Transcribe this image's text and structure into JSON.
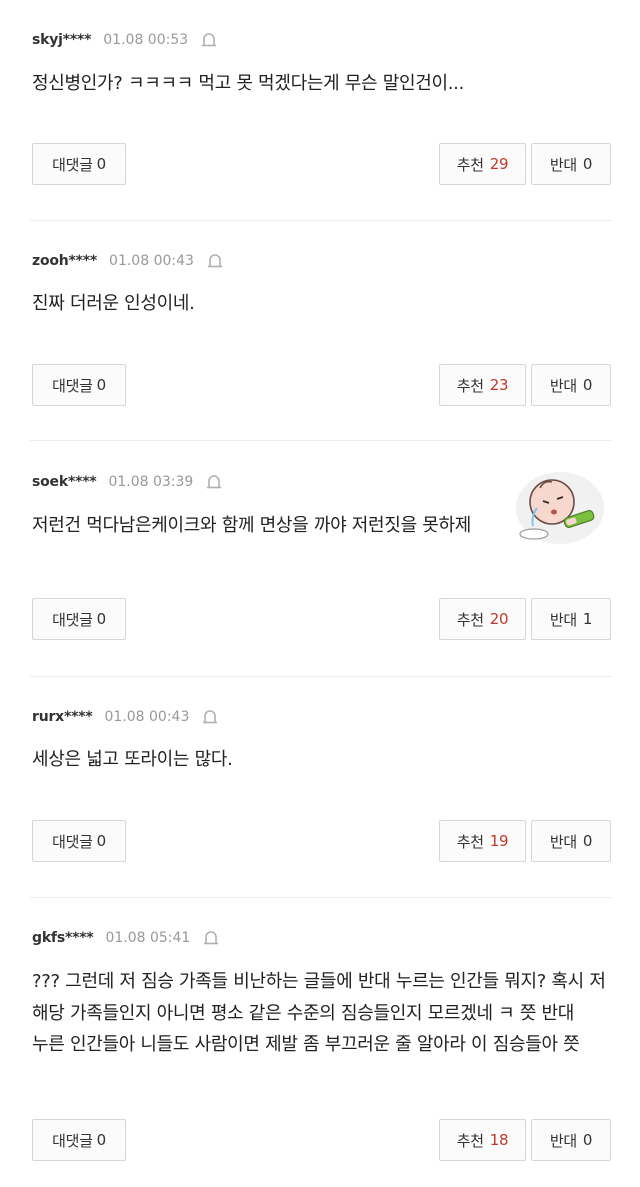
{
  "comments": [
    {
      "user": "skyj****",
      "date": "01.08 00:53",
      "text": "정신병인가? ㅋㅋㅋㅋ 먹고 못 먹겠다는게 무슨 말인건이...",
      "reply_label": "대댓글",
      "reply_count": "0",
      "up_label": "추천",
      "up_count": "29",
      "down_label": "반대",
      "down_count": "0"
    },
    {
      "user": "zooh****",
      "date": "01.08 00:43",
      "text": "진짜 더러운 인성이네.",
      "reply_label": "대댓글",
      "reply_count": "0",
      "up_label": "추천",
      "up_count": "23",
      "down_label": "반대",
      "down_count": "0"
    },
    {
      "user": "soek****",
      "date": "01.08 03:39",
      "text": "저런건 먹다남은케이크와 함께 면상을 까야 저런짓을 못하제",
      "reply_label": "대댓글",
      "reply_count": "0",
      "up_label": "추천",
      "up_count": "20",
      "down_label": "반대",
      "down_count": "1"
    },
    {
      "user": "rurx****",
      "date": "01.08 00:43",
      "text": "세상은 넓고 또라이는 많다.",
      "reply_label": "대댓글",
      "reply_count": "0",
      "up_label": "추천",
      "up_count": "19",
      "down_label": "반대",
      "down_count": "0"
    },
    {
      "user": "gkfs****",
      "date": "01.08 05:41",
      "text": "??? 그런데 저 짐승 가족들 비난하는 글들에 반대 누르는 인간들 뭐지? 혹시 저 해당 가족들인지 아니면 평소 같은 수준의 짐승들인지 모르겠네 ㅋ 쯧 반대 누른 인간들아 니들도 사람이면 제발 좀 부끄러운 줄 알아라 이 짐승들아 쯧",
      "reply_label": "대댓글",
      "reply_count": "0",
      "up_label": "추천",
      "up_count": "18",
      "down_label": "반대",
      "down_count": "0"
    }
  ],
  "icons": {
    "report": "bell-report-icon",
    "sticker": "crying-baby-sticker"
  },
  "colors": {
    "up_count": "#c0392b",
    "divider": "#ececec"
  }
}
